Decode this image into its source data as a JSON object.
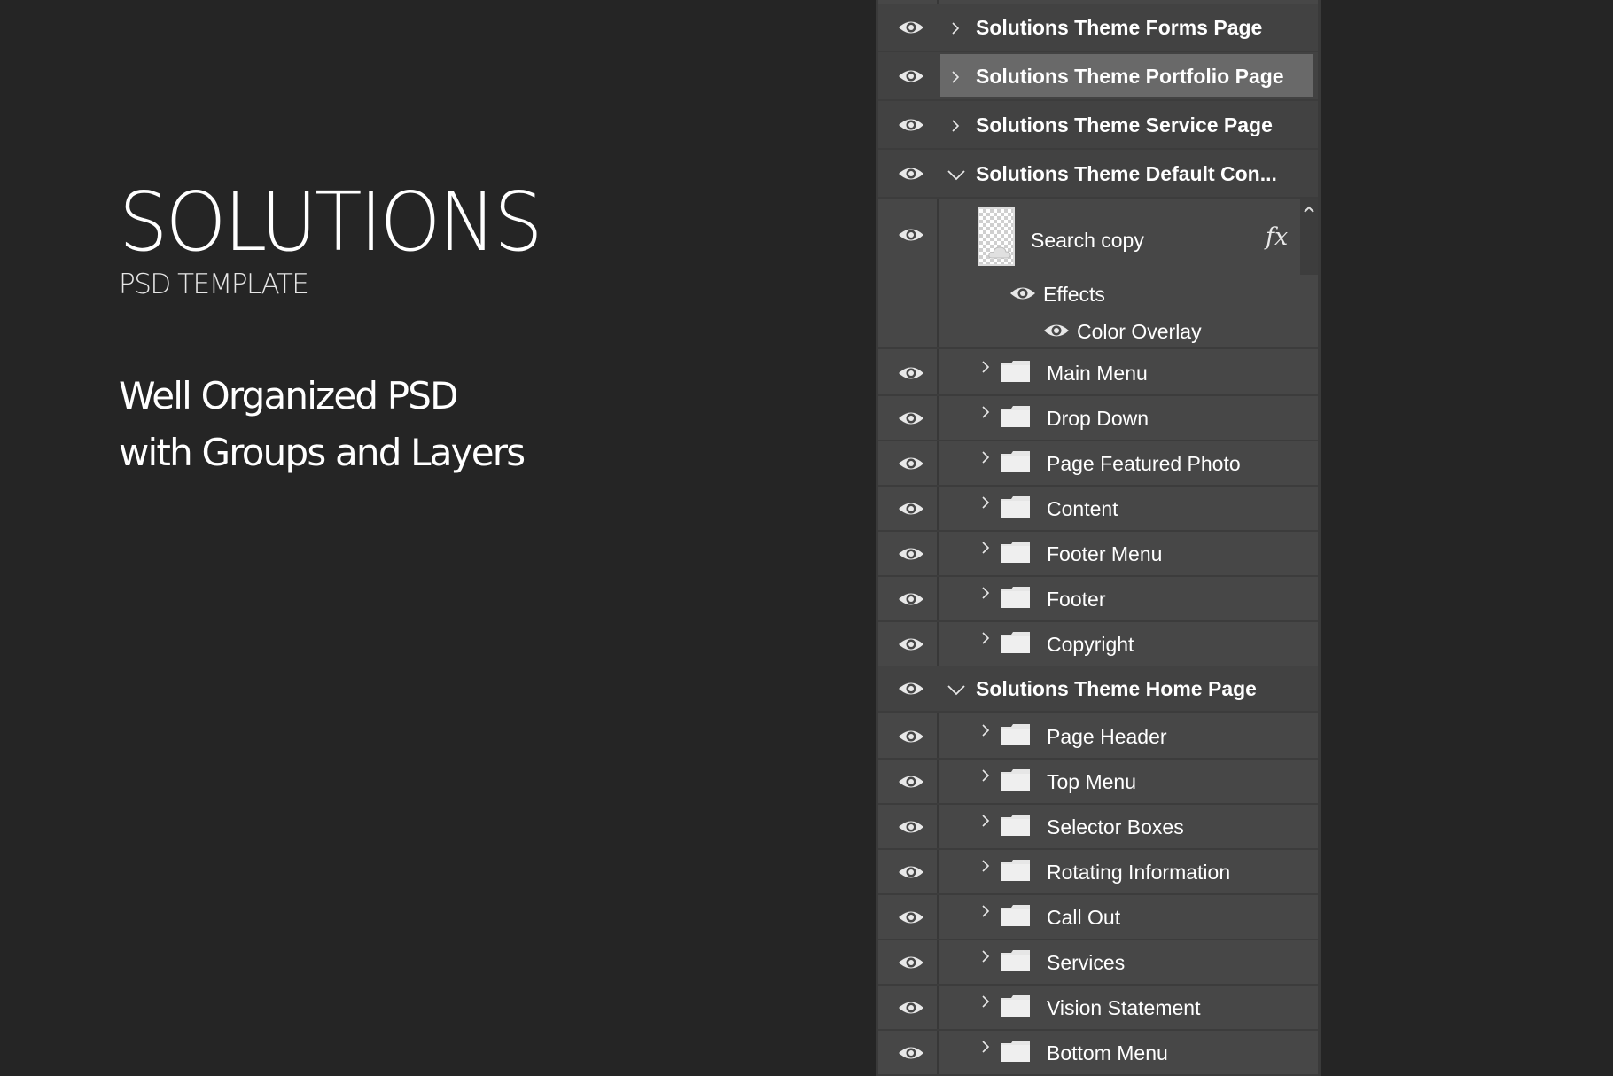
{
  "promo": {
    "title": "SOLUTIONS",
    "subtitle": "PSD TEMPLATE",
    "tagline_line1": "Well Organized PSD",
    "tagline_line2": "with Groups and Layers"
  },
  "layers_panel": {
    "groups_top": [
      {
        "label": "Solutions Theme Forms Page",
        "expanded": false
      },
      {
        "label": "Solutions Theme Portfolio Page",
        "expanded": false,
        "selected": true
      },
      {
        "label": "Solutions Theme Service Page",
        "expanded": false
      },
      {
        "label": "Solutions Theme Default Con...",
        "expanded": true
      }
    ],
    "smart_layer": {
      "label": "Search copy",
      "fx": "fx",
      "effects_label": "Effects",
      "effect_item": "Color Overlay"
    },
    "default_children": [
      "Main Menu",
      "Drop Down",
      "Page Featured Photo",
      "Content",
      "Footer Menu",
      "Footer",
      "Copyright"
    ],
    "home_group": {
      "label": "Solutions Theme Home Page",
      "expanded": true
    },
    "home_children": [
      "Page Header",
      "Top Menu",
      "Selector Boxes",
      "Rotating Information",
      "Call Out",
      "Services",
      "Vision Statement",
      "Bottom Menu"
    ]
  },
  "colors": {
    "background": "#252525",
    "panel": "#474747",
    "selected_row": "#6b6b6b"
  }
}
